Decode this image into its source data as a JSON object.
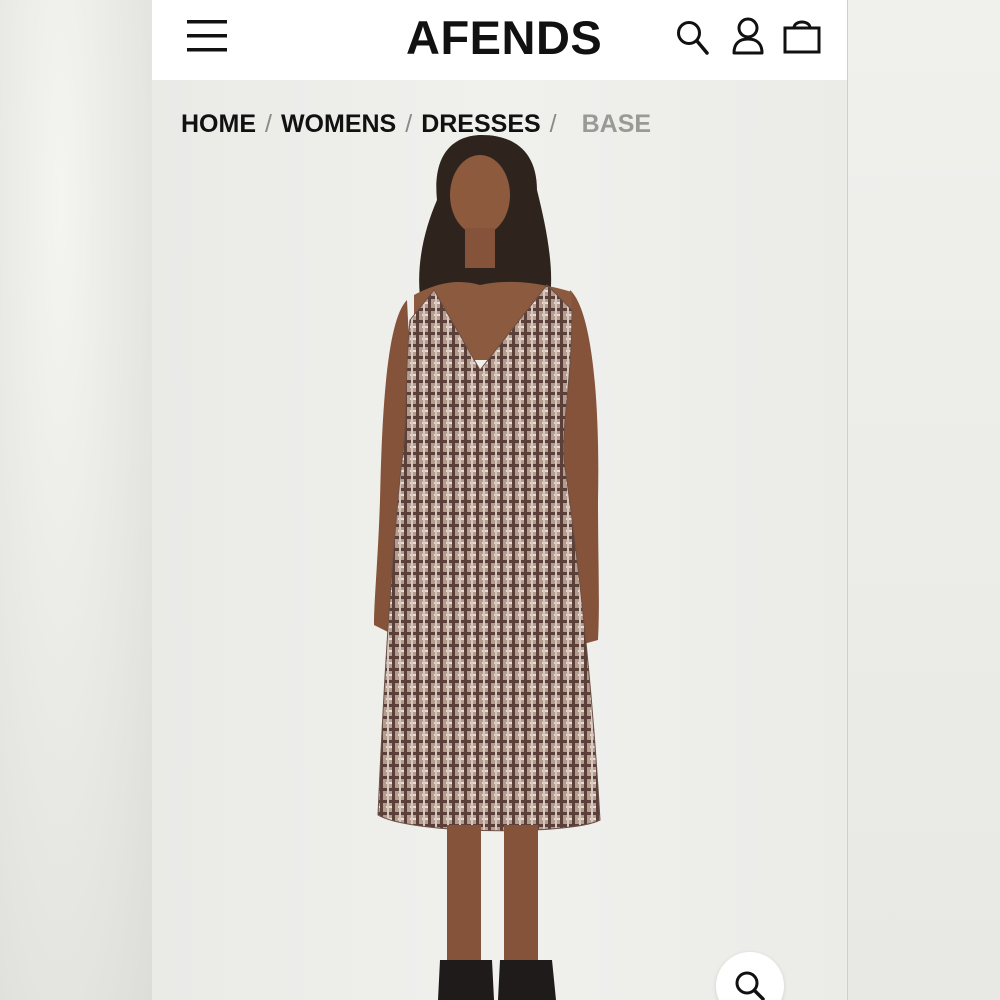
{
  "header": {
    "logo": "AFENDS",
    "menu_icon": "hamburger-menu-icon",
    "search_icon": "search-icon",
    "account_icon": "user-icon",
    "cart_icon": "shopping-bag-icon"
  },
  "breadcrumb": {
    "items": [
      "HOME",
      "WOMENS",
      "DRESSES"
    ],
    "separator": "/",
    "current": "BASE"
  },
  "product_image": {
    "zoom_icon": "magnifier-icon"
  },
  "colors": {
    "header_bg": "#ffffff",
    "text": "#111111",
    "current_crumb": "#999995",
    "photo_bg": "#ededea"
  }
}
